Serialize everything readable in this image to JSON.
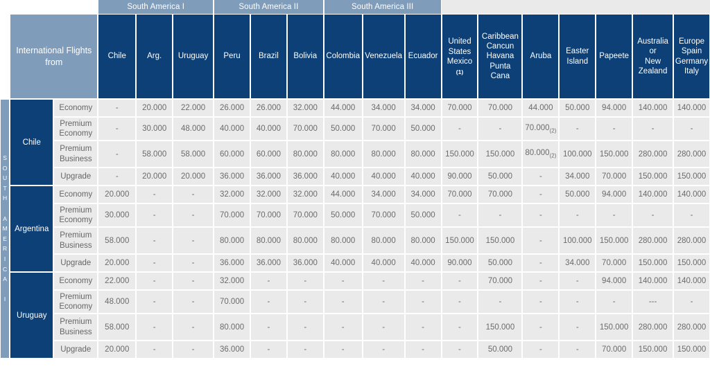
{
  "colors": {
    "header_dark_blue": "#0c4077",
    "header_light_blue": "#7f9cba",
    "cell_background": "#eaeaea",
    "grid_line": "#ffffff",
    "value_text": "#6b6b6b"
  },
  "corner": {
    "title": "International Flights from"
  },
  "region_strip": {
    "label": "SOUTH AMERICA I",
    "letters": [
      "S",
      "O",
      "U",
      "T",
      "H",
      "",
      "A",
      "M",
      "E",
      "R",
      "I",
      "C",
      "A",
      "",
      "I"
    ]
  },
  "group_headers": [
    {
      "label": "South America I",
      "span": 3
    },
    {
      "label": "South America II",
      "span": 3
    },
    {
      "label": "South America III",
      "span": 3
    }
  ],
  "columns": [
    {
      "label": "Chile"
    },
    {
      "label": "Arg."
    },
    {
      "label": "Uruguay"
    },
    {
      "label": "Peru"
    },
    {
      "label": "Brazil"
    },
    {
      "label": "Bolivia"
    },
    {
      "label": "Colombia"
    },
    {
      "label": "Venezuela"
    },
    {
      "label": "Ecuador"
    },
    {
      "label": "United States Mexico",
      "lines": [
        "United",
        "States",
        "Mexico"
      ],
      "footnote": "(1)"
    },
    {
      "label": "Caribbean Cancun Havana Punta Cana",
      "lines": [
        "Caribbean",
        "Cancun",
        "Havana",
        "Punta",
        "Cana"
      ]
    },
    {
      "label": "Aruba"
    },
    {
      "label": "Easter Island",
      "lines": [
        "Easter",
        "Island"
      ]
    },
    {
      "label": "Papeete"
    },
    {
      "label": "Australia or New Zealand",
      "lines": [
        "Australia",
        "or",
        "New",
        "Zealand"
      ]
    },
    {
      "label": "Europe Spain Germany Italy",
      "lines": [
        "Europe",
        "Spain",
        "Germany",
        "Italy"
      ]
    }
  ],
  "cabins": [
    "Economy",
    "Premium Economy",
    "Premium Business",
    "Upgrade"
  ],
  "rows": [
    {
      "country": "Chile",
      "cabins": [
        {
          "cabin": "Economy",
          "lines": [
            "Economy"
          ],
          "values": [
            "-",
            "20.000",
            "22.000",
            "26.000",
            "26.000",
            "32.000",
            "44.000",
            "34.000",
            "34.000",
            "70.000",
            "70.000",
            "44.000",
            "50.000",
            "94.000",
            "140.000",
            "140.000"
          ]
        },
        {
          "cabin": "Premium Economy",
          "lines": [
            "Premium",
            "Economy"
          ],
          "values": [
            "-",
            "30.000",
            "48.000",
            "40.000",
            "40.000",
            "70.000",
            "50.000",
            "70.000",
            "50.000",
            "-",
            "-",
            "70.000",
            "-",
            "-",
            "-",
            "-"
          ],
          "notes": [
            null,
            null,
            null,
            null,
            null,
            null,
            null,
            null,
            null,
            null,
            null,
            "(2)",
            null,
            null,
            null,
            null
          ]
        },
        {
          "cabin": "Premium Business",
          "lines": [
            "Premium",
            "Business"
          ],
          "values": [
            "-",
            "58.000",
            "58.000",
            "60.000",
            "60.000",
            "80.000",
            "80.000",
            "80.000",
            "80.000",
            "150.000",
            "150.000",
            "80.000",
            "100.000",
            "150.000",
            "280.000",
            "280.000"
          ],
          "notes": [
            null,
            null,
            null,
            null,
            null,
            null,
            null,
            null,
            null,
            null,
            null,
            "(2)",
            null,
            null,
            null,
            null
          ]
        },
        {
          "cabin": "Upgrade",
          "lines": [
            "Upgrade"
          ],
          "values": [
            "-",
            "20.000",
            "20.000",
            "36.000",
            "36.000",
            "36.000",
            "40.000",
            "40.000",
            "40.000",
            "90.000",
            "50.000",
            "-",
            "34.000",
            "70.000",
            "150.000",
            "150.000"
          ]
        }
      ]
    },
    {
      "country": "Argentina",
      "cabins": [
        {
          "cabin": "Economy",
          "lines": [
            "Economy"
          ],
          "values": [
            "20.000",
            "-",
            "-",
            "32.000",
            "32.000",
            "32.000",
            "44.000",
            "34.000",
            "34.000",
            "70.000",
            "70.000",
            "-",
            "50.000",
            "94.000",
            "140.000",
            "140.000"
          ]
        },
        {
          "cabin": "Premium Economy",
          "lines": [
            "Premium",
            "Economy"
          ],
          "values": [
            "30.000",
            "-",
            "-",
            "70.000",
            "70.000",
            "70.000",
            "50.000",
            "70.000",
            "50.000",
            "-",
            "-",
            "-",
            "-",
            "-",
            "-",
            "-"
          ]
        },
        {
          "cabin": "Premium Business",
          "lines": [
            "Premium",
            "Business"
          ],
          "values": [
            "58.000",
            "-",
            "-",
            "80.000",
            "80.000",
            "80.000",
            "80.000",
            "80.000",
            "80.000",
            "150.000",
            "150.000",
            "-",
            "100.000",
            "150.000",
            "280.000",
            "280.000"
          ]
        },
        {
          "cabin": "Upgrade",
          "lines": [
            "Upgrade"
          ],
          "values": [
            "20.000",
            "-",
            "-",
            "36.000",
            "36.000",
            "36.000",
            "40.000",
            "40.000",
            "40.000",
            "90.000",
            "50.000",
            "-",
            "34.000",
            "70.000",
            "150.000",
            "150.000"
          ]
        }
      ]
    },
    {
      "country": "Uruguay",
      "cabins": [
        {
          "cabin": "Economy",
          "lines": [
            "Economy"
          ],
          "values": [
            "22.000",
            "-",
            "-",
            "32.000",
            "-",
            "-",
            "-",
            "-",
            "-",
            "-",
            "70.000",
            "-",
            "-",
            "94.000",
            "140.000",
            "140.000"
          ]
        },
        {
          "cabin": "Premium Economy",
          "lines": [
            "Premium",
            "Economy"
          ],
          "values": [
            "48.000",
            "-",
            "-",
            "70.000",
            "-",
            "-",
            "-",
            "-",
            "-",
            "-",
            "-",
            "-",
            "-",
            "-",
            "---",
            "-"
          ]
        },
        {
          "cabin": "Premium Business",
          "lines": [
            "Premium",
            "Business"
          ],
          "values": [
            "58.000",
            "-",
            "-",
            "80.000",
            "-",
            "-",
            "-",
            "-",
            "-",
            "-",
            "150.000",
            "-",
            "-",
            "150.000",
            "280.000",
            "280.000"
          ]
        },
        {
          "cabin": "Upgrade",
          "lines": [
            "Upgrade"
          ],
          "values": [
            "20.000",
            "-",
            "-",
            "36.000",
            "-",
            "-",
            "-",
            "-",
            "-",
            "-",
            "50.000",
            "-",
            "-",
            "70.000",
            "150.000",
            "150.000"
          ]
        }
      ]
    }
  ]
}
